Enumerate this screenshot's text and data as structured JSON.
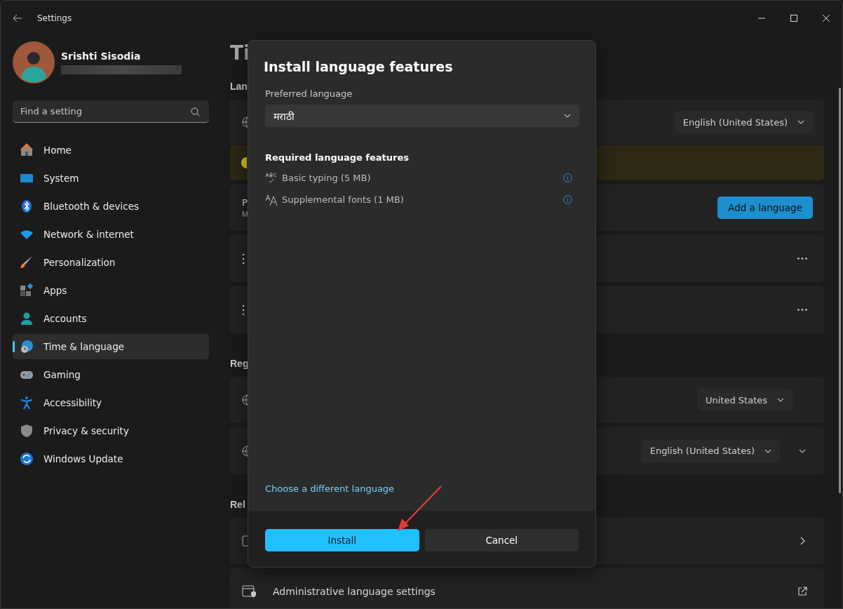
{
  "window": {
    "title": "Settings"
  },
  "user": {
    "name": "Srishti Sisodia"
  },
  "search": {
    "placeholder": "Find a setting"
  },
  "sidebar": {
    "items": [
      {
        "label": "Home",
        "kind": "home",
        "selected": false
      },
      {
        "label": "System",
        "kind": "system",
        "selected": false
      },
      {
        "label": "Bluetooth & devices",
        "kind": "bluetooth",
        "selected": false
      },
      {
        "label": "Network & internet",
        "kind": "network",
        "selected": false
      },
      {
        "label": "Personalization",
        "kind": "brush",
        "selected": false
      },
      {
        "label": "Apps",
        "kind": "apps",
        "selected": false
      },
      {
        "label": "Accounts",
        "kind": "accounts",
        "selected": false
      },
      {
        "label": "Time & language",
        "kind": "time",
        "selected": true
      },
      {
        "label": "Gaming",
        "kind": "gaming",
        "selected": false
      },
      {
        "label": "Accessibility",
        "kind": "accessibility",
        "selected": false
      },
      {
        "label": "Privacy & security",
        "kind": "privacy",
        "selected": false
      },
      {
        "label": "Windows Update",
        "kind": "update",
        "selected": false
      }
    ]
  },
  "page": {
    "title": "Ti",
    "sections": [
      {
        "heading": "Lan",
        "cards": [
          {
            "kind": "select",
            "value": "English (United States)"
          },
          {
            "kind": "warning"
          },
          {
            "kind": "action",
            "title": "P",
            "subtitle": "M",
            "button": "Add a language"
          },
          {
            "kind": "language"
          },
          {
            "kind": "language"
          }
        ]
      },
      {
        "heading": "Reg",
        "cards": [
          {
            "kind": "select",
            "value": "United States"
          },
          {
            "kind": "select_expand",
            "value": "English (United States)"
          }
        ]
      },
      {
        "heading": "Rel",
        "cards": [
          {
            "kind": "link"
          },
          {
            "kind": "external",
            "label": "Administrative language settings"
          }
        ]
      }
    ]
  },
  "dialog": {
    "title": "Install language features",
    "field_label": "Preferred language",
    "language": "मराठी",
    "features_heading": "Required language features",
    "features": [
      {
        "kind": "typing",
        "label": "Basic typing (5 MB)"
      },
      {
        "kind": "fonts",
        "label": "Supplemental fonts (1 MB)"
      }
    ],
    "link": "Choose a different language",
    "buttons": [
      {
        "label": "Install",
        "kind": "primary"
      },
      {
        "label": "Cancel",
        "kind": "secondary"
      }
    ]
  }
}
